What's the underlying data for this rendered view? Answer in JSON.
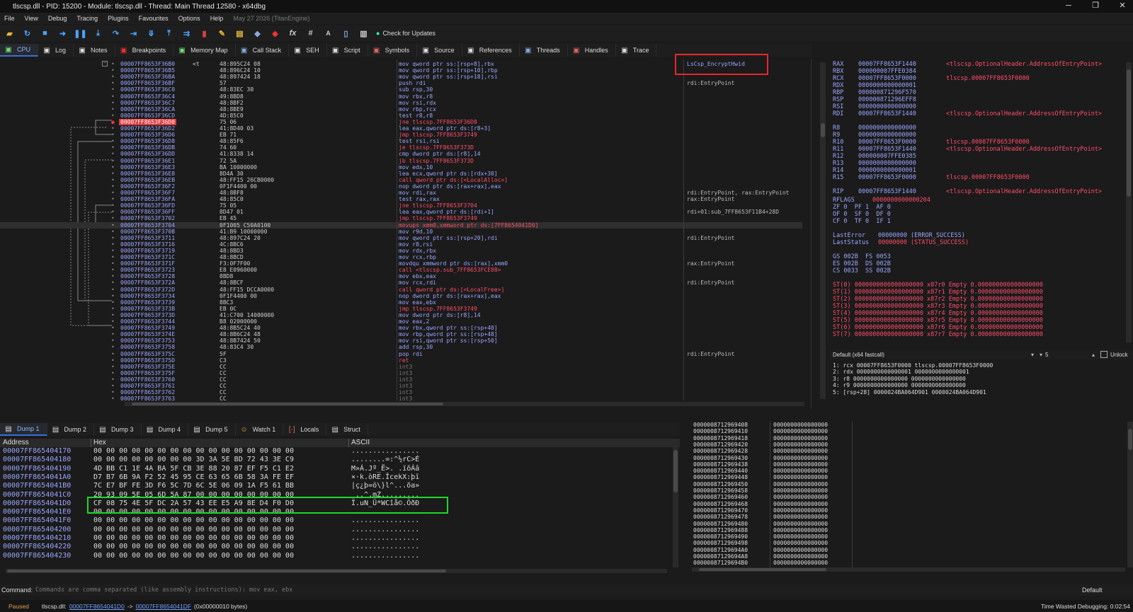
{
  "window": {
    "title": "tlscsp.dll - PID: 15200 - Module: tlscsp.dll - Thread: Main Thread 12580 - x64dbg"
  },
  "menu": {
    "items": [
      "File",
      "View",
      "Debug",
      "Tracing",
      "Plugins",
      "Favourites",
      "Options",
      "Help"
    ],
    "date": "May 27 2026 (TitanEngine)"
  },
  "toolbar": {
    "check_updates": "Check for Updates"
  },
  "top_tabs": [
    {
      "label": "CPU",
      "icon": "cpu-icon"
    },
    {
      "label": "Log",
      "icon": "log-icon"
    },
    {
      "label": "Notes",
      "icon": "notes-icon"
    },
    {
      "label": "Breakpoints",
      "icon": "breakpoint-icon"
    },
    {
      "label": "Memory Map",
      "icon": "memory-icon"
    },
    {
      "label": "Call Stack",
      "icon": "callstack-icon"
    },
    {
      "label": "SEH",
      "icon": "seh-icon"
    },
    {
      "label": "Script",
      "icon": "script-icon"
    },
    {
      "label": "Symbols",
      "icon": "symbols-icon"
    },
    {
      "label": "Source",
      "icon": "source-icon"
    },
    {
      "label": "References",
      "icon": "references-icon"
    },
    {
      "label": "Threads",
      "icon": "threads-icon"
    },
    {
      "label": "Handles",
      "icon": "handles-icon"
    },
    {
      "label": "Trace",
      "icon": "trace-icon"
    }
  ],
  "disasm": [
    {
      "addr": "00007FF8653F36B0",
      "bytes": "48:895C24 08",
      "instr": "mov qword ptr ss:[rsp+8],rbx",
      "cmt": "LsCsp_EncryptHwid",
      "pre": "<t"
    },
    {
      "addr": "00007FF8653F36B5",
      "bytes": "48:896C24 10",
      "instr": "mov qword ptr ss:[rsp+10],rbp",
      "cmt": ""
    },
    {
      "addr": "00007FF8653F36BA",
      "bytes": "48:897424 18",
      "instr": "mov qword ptr ss:[rsp+18],rsi",
      "cmt": ""
    },
    {
      "addr": "00007FF8653F36BF",
      "bytes": "57",
      "instr": "push rdi",
      "cmt": "rdi:EntryPoint"
    },
    {
      "addr": "00007FF8653F36C0",
      "bytes": "48:83EC 30",
      "instr": "sub rsp,30",
      "cmt": ""
    },
    {
      "addr": "00007FF8653F36C4",
      "bytes": "49:8BD8",
      "instr": "mov rbx,r8",
      "cmt": ""
    },
    {
      "addr": "00007FF8653F36C7",
      "bytes": "48:8BF2",
      "instr": "mov rsi,rdx",
      "cmt": ""
    },
    {
      "addr": "00007FF8653F36CA",
      "bytes": "48:8BE9",
      "instr": "mov rbp,rcx",
      "cmt": ""
    },
    {
      "addr": "00007FF8653F36CD",
      "bytes": "4D:85C0",
      "instr": "test r8,r8",
      "cmt": ""
    },
    {
      "addr": "00007FF8653F36D0",
      "bytes": "75 06",
      "instr": "jne tlscsp.7FF8653F36D8",
      "cmt": "",
      "hl": true
    },
    {
      "addr": "00007FF8653F36D2",
      "bytes": "41:8D40 03",
      "instr": "lea eax,qword ptr ds:[r8+3]",
      "cmt": ""
    },
    {
      "addr": "00007FF8653F36D6",
      "bytes": "EB 71",
      "instr": "jmp tlscsp.7FF8653F3749",
      "cmt": ""
    },
    {
      "addr": "00007FF8653F36D8",
      "bytes": "48:85F6",
      "instr": "test rsi,rsi",
      "cmt": ""
    },
    {
      "addr": "00007FF8653F36DB",
      "bytes": "74 60",
      "instr": "je tlscsp.7FF8653F373D",
      "cmt": ""
    },
    {
      "addr": "00007FF8653F36DD",
      "bytes": "41:8338 14",
      "instr": "cmp dword ptr ds:[r8],14",
      "cmt": ""
    },
    {
      "addr": "00007FF8653F36E1",
      "bytes": "72 5A",
      "instr": "jb tlscsp.7FF8653F373D",
      "cmt": ""
    },
    {
      "addr": "00007FF8653F36E3",
      "bytes": "BA 10000000",
      "instr": "mov edx,10",
      "cmt": ""
    },
    {
      "addr": "00007FF8653F36E8",
      "bytes": "8D4A 30",
      "instr": "lea ecx,qword ptr ds:[rdx+30]",
      "cmt": ""
    },
    {
      "addr": "00007FF8653F36EB",
      "bytes": "48:FF15 26CB0000",
      "instr": "call qword ptr ds:[<LocalAlloc>]",
      "cmt": ""
    },
    {
      "addr": "00007FF8653F36F2",
      "bytes": "0F1F4400 00",
      "instr": "nop dword ptr ds:[rax+rax],eax",
      "cmt": ""
    },
    {
      "addr": "00007FF8653F36F7",
      "bytes": "48:8BF8",
      "instr": "mov rdi,rax",
      "cmt": "rdi:EntryPoint, rax:EntryPoint"
    },
    {
      "addr": "00007FF8653F36FA",
      "bytes": "48:85C0",
      "instr": "test rax,rax",
      "cmt": "rax:EntryPoint"
    },
    {
      "addr": "00007FF8653F36FD",
      "bytes": "75 05",
      "instr": "jne tlscsp.7FF8653F3704",
      "cmt": ""
    },
    {
      "addr": "00007FF8653F36FF",
      "bytes": "8D47 01",
      "instr": "lea eax,qword ptr ds:[rdi+1]",
      "cmt": "rdi+01:sub_7FF8653F11B4+28D"
    },
    {
      "addr": "00007FF8653F3702",
      "bytes": "EB 45",
      "instr": "jmp tlscsp.7FF8653F3749",
      "cmt": ""
    },
    {
      "addr": "00007FF8653F3704",
      "bytes": "0F1005 C50A0100",
      "instr": "movups xmm0,xmmword ptr ds:[7FF8654041D0]",
      "cmt": "",
      "cur": true
    },
    {
      "addr": "00007FF8653F370B",
      "bytes": "41:B9 10000000",
      "instr": "mov r9d,10",
      "cmt": ""
    },
    {
      "addr": "00007FF8653F3711",
      "bytes": "48:897C24 20",
      "instr": "mov qword ptr ss:[rsp+20],rdi",
      "cmt": "rdi:EntryPoint"
    },
    {
      "addr": "00007FF8653F3716",
      "bytes": "4C:8BC6",
      "instr": "mov r8,rsi",
      "cmt": ""
    },
    {
      "addr": "00007FF8653F3719",
      "bytes": "48:8BD3",
      "instr": "mov rdx,rbx",
      "cmt": ""
    },
    {
      "addr": "00007FF8653F371C",
      "bytes": "48:8BCD",
      "instr": "mov rcx,rbp",
      "cmt": ""
    },
    {
      "addr": "00007FF8653F371F",
      "bytes": "F3:0F7F00",
      "instr": "movdqu xmmword ptr ds:[rax],xmm0",
      "cmt": "rax:EntryPoint"
    },
    {
      "addr": "00007FF8653F3723",
      "bytes": "E8 E0960000",
      "instr": "call <tlscsp.sub_7FF8653FCE08>",
      "cmt": ""
    },
    {
      "addr": "00007FF8653F3728",
      "bytes": "8BD8",
      "instr": "mov ebx,eax",
      "cmt": ""
    },
    {
      "addr": "00007FF8653F372A",
      "bytes": "48:8BCF",
      "instr": "mov rcx,rdi",
      "cmt": "rdi:EntryPoint"
    },
    {
      "addr": "00007FF8653F372D",
      "bytes": "48:FF15 DCCA0000",
      "instr": "call qword ptr ds:[<LocalFree>]",
      "cmt": ""
    },
    {
      "addr": "00007FF8653F3734",
      "bytes": "0F1F4400 00",
      "instr": "nop dword ptr ds:[rax+rax],eax",
      "cmt": ""
    },
    {
      "addr": "00007FF8653F3739",
      "bytes": "8BC3",
      "instr": "mov eax,ebx",
      "cmt": ""
    },
    {
      "addr": "00007FF8653F373B",
      "bytes": "EB 0C",
      "instr": "jmp tlscsp.7FF8653F3749",
      "cmt": ""
    },
    {
      "addr": "00007FF8653F373D",
      "bytes": "41:C700 14000000",
      "instr": "mov dword ptr ds:[r8],14",
      "cmt": ""
    },
    {
      "addr": "00007FF8653F3744",
      "bytes": "B8 02000000",
      "instr": "mov eax,2",
      "cmt": ""
    },
    {
      "addr": "00007FF8653F3749",
      "bytes": "48:8B5C24 40",
      "instr": "mov rbx,qword ptr ss:[rsp+40]",
      "cmt": ""
    },
    {
      "addr": "00007FF8653F374E",
      "bytes": "48:8B6C24 48",
      "instr": "mov rbp,qword ptr ss:[rsp+48]",
      "cmt": ""
    },
    {
      "addr": "00007FF8653F3753",
      "bytes": "48:8B7424 50",
      "instr": "mov rsi,qword ptr ss:[rsp+50]",
      "cmt": ""
    },
    {
      "addr": "00007FF8653F3758",
      "bytes": "48:83C4 30",
      "instr": "add rsp,30",
      "cmt": ""
    },
    {
      "addr": "00007FF8653F375C",
      "bytes": "5F",
      "instr": "pop rdi",
      "cmt": "rdi:EntryPoint"
    },
    {
      "addr": "00007FF8653F375D",
      "bytes": "C3",
      "instr": "ret",
      "cmt": "",
      "red": true
    },
    {
      "addr": "00007FF8653F375E",
      "bytes": "CC",
      "instr": "int3",
      "cmt": "",
      "grey": true
    },
    {
      "addr": "00007FF8653F375F",
      "bytes": "CC",
      "instr": "int3",
      "cmt": "",
      "grey": true
    },
    {
      "addr": "00007FF8653F3760",
      "bytes": "CC",
      "instr": "int3",
      "cmt": "",
      "grey": true
    },
    {
      "addr": "00007FF8653F3761",
      "bytes": "CC",
      "instr": "int3",
      "cmt": "",
      "grey": true
    },
    {
      "addr": "00007FF8653F3762",
      "bytes": "CC",
      "instr": "int3",
      "cmt": "",
      "grey": true
    },
    {
      "addr": "00007FF8653F3763",
      "bytes": "CC",
      "instr": "int3",
      "cmt": "",
      "grey": true
    }
  ],
  "registers": [
    {
      "n": "RAX",
      "v": "00007FF8653F1440",
      "c": "<tlscsp.OptionalHeader.AddressOfEntryPoint>"
    },
    {
      "n": "RBX",
      "v": "000000007FFE0384",
      "c": ""
    },
    {
      "n": "RCX",
      "v": "00007FF8653F0000",
      "c": "tlscsp.00007FF8653F0000"
    },
    {
      "n": "RDX",
      "v": "0000000000000001",
      "c": ""
    },
    {
      "n": "RBP",
      "v": "000000871296F570",
      "c": ""
    },
    {
      "n": "RSP",
      "v": "000000871296EFF8",
      "c": ""
    },
    {
      "n": "RSI",
      "v": "0000000000000000",
      "c": ""
    },
    {
      "n": "RDI",
      "v": "00007FF8653F1440",
      "c": "<tlscsp.OptionalHeader.AddressOfEntryPoint>"
    },
    {
      "n": "",
      "v": "",
      "c": ""
    },
    {
      "n": "R8",
      "v": "0000000000000000",
      "c": ""
    },
    {
      "n": "R9",
      "v": "0000000000000000",
      "c": ""
    },
    {
      "n": "R10",
      "v": "00007FF8653F0000",
      "c": "tlscsp.00007FF8653F0000"
    },
    {
      "n": "R11",
      "v": "00007FF8653F1440",
      "c": "<tlscsp.OptionalHeader.AddressOfEntryPoint>"
    },
    {
      "n": "R12",
      "v": "000000007FFE0385",
      "c": ""
    },
    {
      "n": "R13",
      "v": "0000000000000000",
      "c": ""
    },
    {
      "n": "R14",
      "v": "0000000000000001",
      "c": ""
    },
    {
      "n": "R15",
      "v": "00007FF8653F0000",
      "c": "tlscsp.00007FF8653F0000"
    },
    {
      "n": "",
      "v": "",
      "c": ""
    },
    {
      "n": "RIP",
      "v": "00007FF8653F1440",
      "c": "<tlscsp.OptionalHeader.AddressOfEntryPoint>"
    }
  ],
  "rflags": {
    "label": "RFLAGS",
    "value": "0000000000000204"
  },
  "flags": [
    "ZF 0  PF 1  AF 0",
    "OF 0  SF 0  DF 0",
    "CF 0  TF 0  IF 1"
  ],
  "last_error": {
    "label": "LastError",
    "value": "00000000 (ERROR_SUCCESS)"
  },
  "last_status": {
    "label": "LastStatus",
    "value": "00000000 (STATUS_SUCCESS)"
  },
  "segments": [
    "GS 002B  FS 0053",
    "ES 002B  DS 002B",
    "CS 0033  SS 002B"
  ],
  "fpu": [
    "ST(0) 0000000000000000000 x87r0 Empty 0.000000000000000000",
    "ST(1) 0000000000000000000 x87r1 Empty 0.000000000000000000",
    "ST(2) 0000000000000000000 x87r2 Empty 0.000000000000000000",
    "ST(3) 0000000000000000000 x87r3 Empty 0.000000000000000000",
    "ST(4) 0000000000000000000 x87r4 Empty 0.000000000000000000",
    "ST(5) 0000000000000000000 x87r5 Empty 0.000000000000000000",
    "ST(6) 0000000000000000000 x87r6 Empty 0.000000000000000000",
    "ST(7) 0000000000000000000 x87r7 Empty 0.000000000000000000"
  ],
  "callconv": {
    "label": "Default (x64 fastcall)",
    "count": "5",
    "unlock": "Unlock"
  },
  "args": [
    "1: rcx 00007FF8653F0000 tlscsp.00007FF8653F0000",
    "2: rdx 0000000000000001 0000000000000001",
    "3: r8 0000000000000000 0000000000000000",
    "4: r9 0000000000000000 0000000000000000",
    "5: [rsp+28] 0000024BA064D901 0000024BA064D901"
  ],
  "dump_tabs": [
    {
      "label": "Dump 1",
      "icon": "dump-icon"
    },
    {
      "label": "Dump 2",
      "icon": "dump-icon"
    },
    {
      "label": "Dump 3",
      "icon": "dump-icon"
    },
    {
      "label": "Dump 4",
      "icon": "dump-icon"
    },
    {
      "label": "Dump 5",
      "icon": "dump-icon"
    },
    {
      "label": "Watch 1",
      "icon": "watch-icon"
    },
    {
      "label": "Locals",
      "icon": "locals-icon"
    },
    {
      "label": "Struct",
      "icon": "struct-icon"
    }
  ],
  "dump_headers": {
    "address": "Address",
    "hex": "Hex",
    "ascii": "ASCII"
  },
  "dump": [
    {
      "a": "00007FF865404170",
      "h": "00 00 00 00 00 00 00 00 00 00 00 00 00 00 00 00",
      "c": "................"
    },
    {
      "a": "00007FF865404180",
      "h": "00 00 00 00 00 00 00 00 3D 3A 5E BD 72 43 3E C9",
      "c": "........=:^½rC>É"
    },
    {
      "a": "00007FF865404190",
      "h": "4D BB C1 1E 4A BA 5F CB 3E 88 20 87 EF F5 C1 E2",
      "c": "M»Á.Jº_Ë>. .ïõÁâ"
    },
    {
      "a": "00007FF8654041A0",
      "h": "D7 B7 6B 9A F2 52 45 95 CE 63 65 6B 58 3A FE EF",
      "c": "×·k.òRE.ÎcekX:þï"
    },
    {
      "a": "00007FF8654041B0",
      "h": "7C E7 BF FE 3D F6 5C 7D 6C 5E 06 09 1A F5 61 BB",
      "c": "|ç¿þ=ö\\}l^...õa»"
    },
    {
      "a": "00007FF8654041C0",
      "h": "20 93 09 5E 05 6D 5A 87 00 00 00 00 00 00 00 00",
      "c": " ..^.mZ........."
    },
    {
      "a": "00007FF8654041D0",
      "h": "CF 08 75 4E 5F DC 2A 57 43 EE E5 A9 8E D4 F0 D0",
      "c": "Ï.uN_Ü*WCîå©.ÔðÐ"
    },
    {
      "a": "00007FF8654041E0",
      "h": "00 00 00 00 00 00 00 00 00 00 00 00 00 00 00 00",
      "c": "................"
    },
    {
      "a": "00007FF8654041F0",
      "h": "00 00 00 00 00 00 00 00 00 00 00 00 00 00 00 00",
      "c": "................"
    },
    {
      "a": "00007FF865404200",
      "h": "00 00 00 00 00 00 00 00 00 00 00 00 00 00 00 00",
      "c": "................"
    },
    {
      "a": "00007FF865404210",
      "h": "00 00 00 00 00 00 00 00 00 00 00 00 00 00 00 00",
      "c": "................"
    },
    {
      "a": "00007FF865404220",
      "h": "00 00 00 00 00 00 00 00 00 00 00 00 00 00 00 00",
      "c": "................"
    },
    {
      "a": "00007FF865404230",
      "h": "00 00 00 00 00 00 00 00 00 00 00 00 00 00 00 00",
      "c": "................"
    }
  ],
  "stack": [
    {
      "a": "0000008712969408",
      "v": "0000000000000000"
    },
    {
      "a": "0000008712969410",
      "v": "0000000000000000"
    },
    {
      "a": "0000008712969418",
      "v": "0000000000000000"
    },
    {
      "a": "0000008712969420",
      "v": "0000000000000000"
    },
    {
      "a": "0000008712969428",
      "v": "0000000000000000"
    },
    {
      "a": "0000008712969430",
      "v": "0000000000000000"
    },
    {
      "a": "0000008712969438",
      "v": "0000000000000000"
    },
    {
      "a": "0000008712969440",
      "v": "0000000000000000"
    },
    {
      "a": "0000008712969448",
      "v": "0000000000000000"
    },
    {
      "a": "0000008712969450",
      "v": "0000000000000000"
    },
    {
      "a": "0000008712969458",
      "v": "0000000000000000"
    },
    {
      "a": "0000008712969460",
      "v": "0000000000000000"
    },
    {
      "a": "0000008712969468",
      "v": "0000000000000000"
    },
    {
      "a": "0000008712969470",
      "v": "0000000000000000"
    },
    {
      "a": "0000008712969478",
      "v": "0000000000000000"
    },
    {
      "a": "0000008712969480",
      "v": "0000000000000000"
    },
    {
      "a": "0000008712969488",
      "v": "0000000000000000"
    },
    {
      "a": "0000008712969490",
      "v": "0000000000000000"
    },
    {
      "a": "0000008712969498",
      "v": "0000000000000000"
    },
    {
      "a": "00000087129694A0",
      "v": "0000000000000000"
    },
    {
      "a": "00000087129694A8",
      "v": "0000000000000000"
    },
    {
      "a": "00000087129694B0",
      "v": "0000000000000000"
    }
  ],
  "command": {
    "label": "Command:",
    "placeholder": "Commands are comma separated (like assembly instructions): mov eax, ebx",
    "mode": "Default"
  },
  "status": {
    "state": "Paused",
    "module": "tlscsp.dll:",
    "from": "00007FF8654041D0",
    "arrow": "->",
    "to": "00007FF8654041DF",
    "size": "(0x00000010 bytes)",
    "time": "Time Wasted Debugging: 0:02:54"
  },
  "colors": {
    "accent": "#3b6fd8",
    "address": "#9aa6ff",
    "red": "#ff4d6a",
    "highlight_red": "#e8262c",
    "highlight_green": "#1ed82a"
  }
}
